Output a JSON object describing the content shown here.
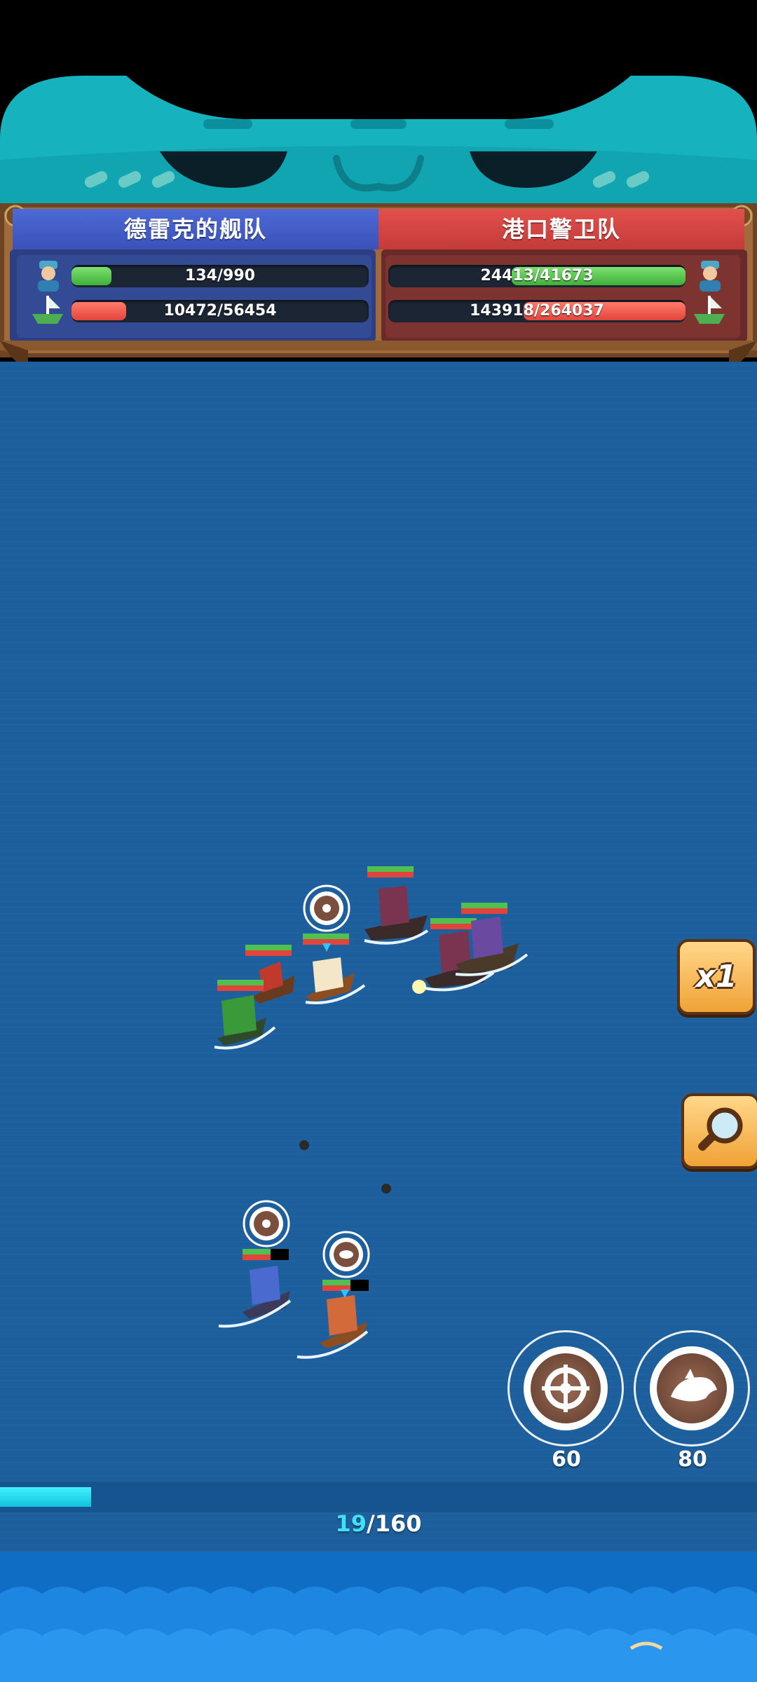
{
  "left_team": {
    "name": "德雷克的舰队",
    "crew_text": "134/990",
    "crew_fraction": 0.135,
    "hull_text": "10472/56454",
    "hull_fraction": 0.185
  },
  "right_team": {
    "name": "港口警卫队",
    "crew_text": "24413/41673",
    "crew_fraction": 0.586,
    "hull_text": "143918/264037",
    "hull_fraction": 0.545
  },
  "controls": {
    "speed_label": "x1",
    "zoom_icon": "magnifier-icon"
  },
  "skills": [
    {
      "icon": "helm-wheel-icon",
      "count": "60"
    },
    {
      "icon": "ram-shark-icon",
      "count": "80"
    }
  ],
  "wave": {
    "current": "19",
    "total": "/160",
    "fraction": 0.12
  },
  "colors": {
    "left_team": "#3e55bf",
    "right_team": "#d3433f",
    "sea": "#1d5f9c",
    "progress": "#25dbf0"
  }
}
